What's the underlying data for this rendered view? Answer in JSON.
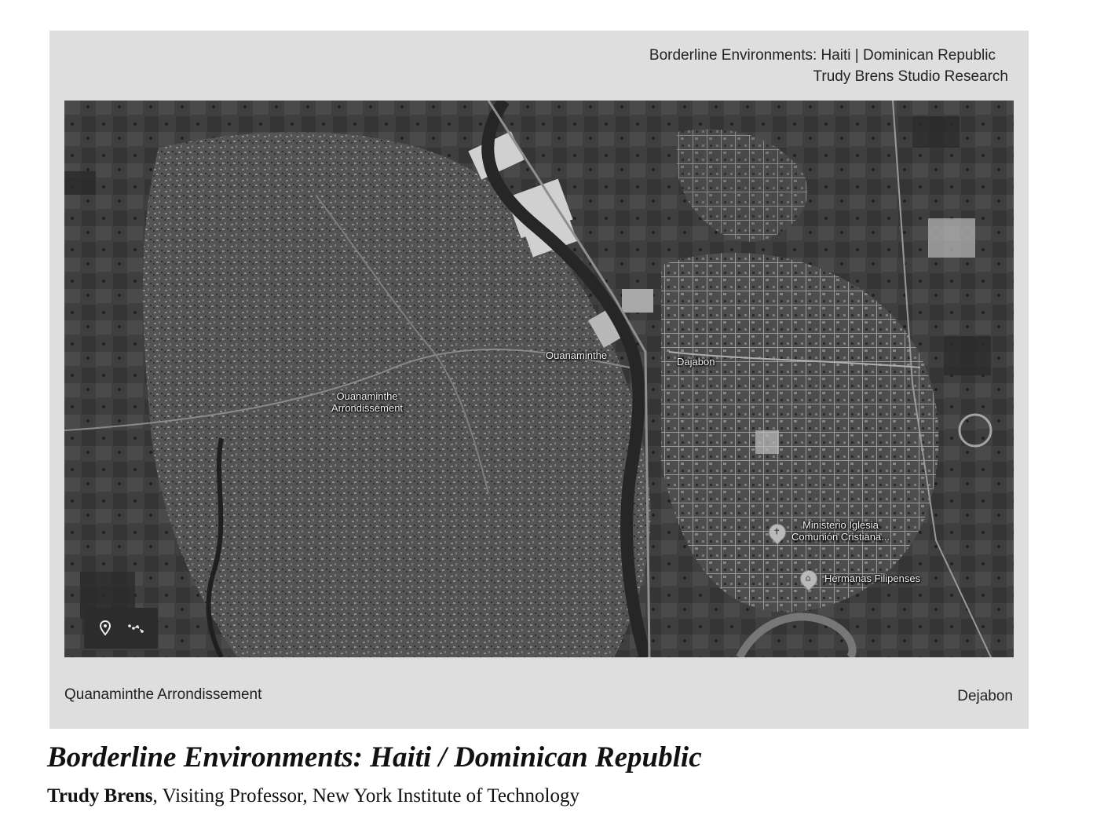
{
  "header": {
    "line1": "Borderline Environments: Haiti | Dominican Republic",
    "line2": "Trudy Brens Studio Research"
  },
  "map": {
    "labels": {
      "ouanaminthe_arr_1": "Ouanaminthe",
      "ouanaminthe_arr_2": "Arrondissement",
      "ouanaminthe": "Ouanaminthe",
      "dajabon": "Dajabon",
      "ministerio_1": "Ministerio Iglesia",
      "ministerio_2": "Comunión Cristiana...",
      "hermanas": "Hermanas Filipenses"
    },
    "controls": [
      "location-pin-icon",
      "route-icon"
    ]
  },
  "footer": {
    "left": "Quanaminthe Arrondissement",
    "right": "Dejabon"
  },
  "caption": {
    "title": "Borderline Environments: Haiti / Dominican Republic",
    "author": "Trudy Brens",
    "affiliation": ", Visiting Professor, New York Institute of Technology"
  },
  "colors": {
    "panel": "#dedede",
    "map_base": "#3a3a3a",
    "river": "#262626"
  }
}
